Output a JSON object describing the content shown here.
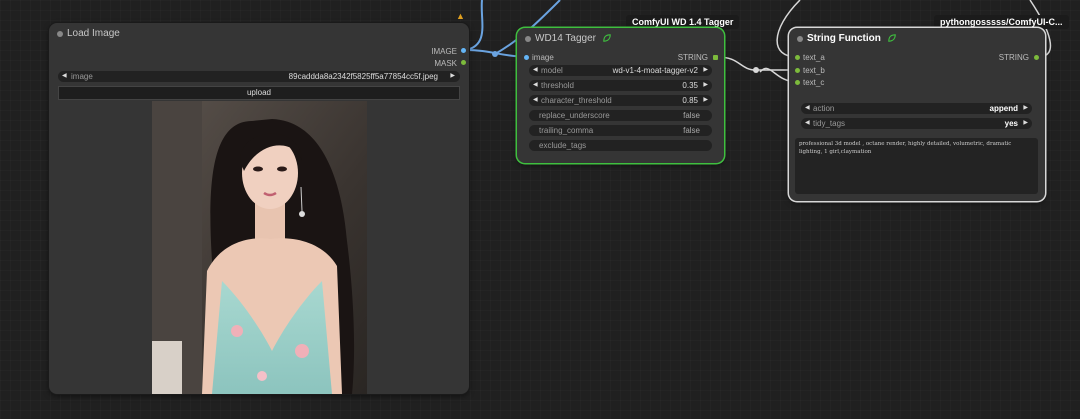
{
  "load_image": {
    "title": "Load Image",
    "outputs": {
      "image": "IMAGE",
      "mask": "MASK"
    },
    "widget_image_label": "image",
    "widget_image_value": "89caddda8a2342f5825ff5a77854cc5f.jpeg",
    "upload_label": "upload"
  },
  "wd14": {
    "badge": "ComfyUI WD 1.4 Tagger",
    "title": "WD14 Tagger",
    "input_image": "image",
    "output_string": "STRING",
    "model_label": "model",
    "model_value": "wd-v1-4-moat-tagger-v2",
    "threshold_label": "threshold",
    "threshold_value": "0.35",
    "char_threshold_label": "character_threshold",
    "char_threshold_value": "0.85",
    "replace_underscore_label": "replace_underscore",
    "replace_underscore_value": "false",
    "trailing_comma_label": "trailing_comma",
    "trailing_comma_value": "false",
    "exclude_tags_label": "exclude_tags"
  },
  "string_function": {
    "badge": "pythongosssss/ComfyUI-C...",
    "title": "String Function",
    "inputs": [
      "text_a",
      "text_b",
      "text_c"
    ],
    "output_string": "STRING",
    "action_label": "action",
    "action_value": "append",
    "tidy_label": "tidy_tags",
    "tidy_value": "yes",
    "text": "professional 3d model , octane render, highly detailed, volumetric, dramatic lighting, 1 girl,claymation"
  },
  "colors": {
    "image_slot": "#64b5f6",
    "string_slot": "#7dbb3c",
    "wire_image": "#6aa3e0",
    "wire_string": "#d8d8d8",
    "selected_green": "#3fbf3f"
  },
  "icons": [
    "leaf-icon",
    "arrow-left-icon",
    "arrow-right-icon",
    "fox-icon"
  ]
}
